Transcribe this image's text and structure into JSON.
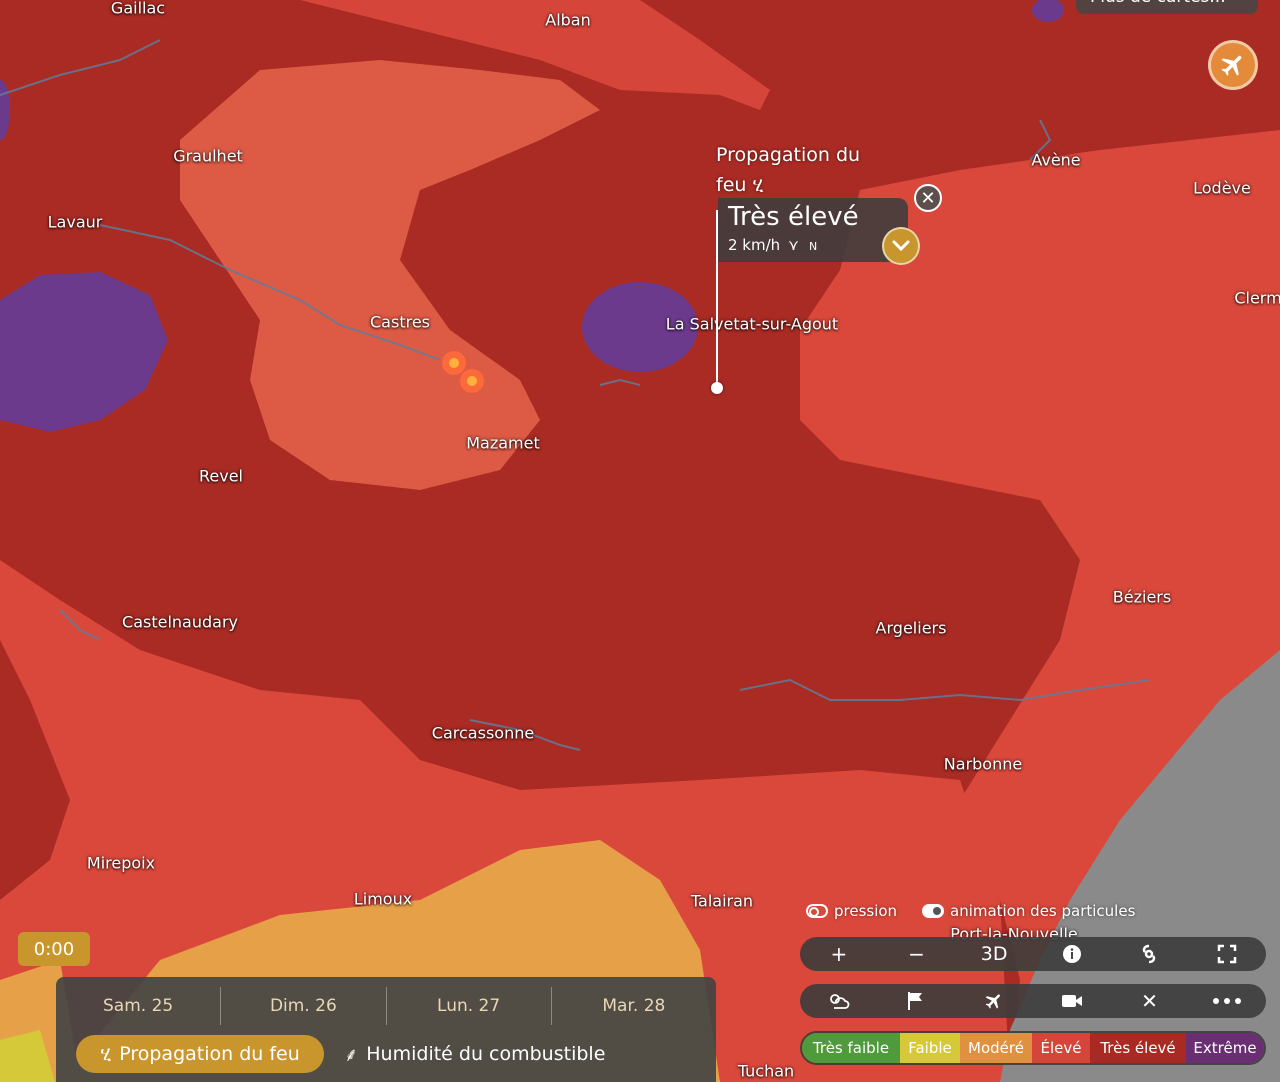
{
  "cities": [
    {
      "name": "Gaillac"
    },
    {
      "name": "Alban"
    },
    {
      "name": "Graulhet"
    },
    {
      "name": "Lavaur"
    },
    {
      "name": "Castres"
    },
    {
      "name": "La Salvetat-sur-Agout"
    },
    {
      "name": "Mazamet"
    },
    {
      "name": "Revel"
    },
    {
      "name": "Castelnaudary"
    },
    {
      "name": "Carcassonne"
    },
    {
      "name": "Mirepoix"
    },
    {
      "name": "Limoux"
    },
    {
      "name": "Talairan"
    },
    {
      "name": "Tuchan"
    },
    {
      "name": "Argeliers"
    },
    {
      "name": "Narbonne"
    },
    {
      "name": "Béziers"
    },
    {
      "name": "Avène"
    },
    {
      "name": "Lodève"
    },
    {
      "name": "Clerm"
    },
    {
      "name": "Port-la-Nouvelle"
    }
  ],
  "popup": {
    "title": "Propagation du feu",
    "level": "Très élevé",
    "wind": "2 km/h",
    "wind_dir_letter": "N",
    "close_icon": "close-icon",
    "expand_icon": "chevron-down-icon"
  },
  "top_right": {
    "more_maps": "Plus de cartes...",
    "plane_icon": "airplane-icon"
  },
  "toggles": {
    "pressure": "pression",
    "particles": "animation des particules",
    "pressure_on": false,
    "particles_on": true
  },
  "toolbar1": {
    "zoom_in": "+",
    "zoom_out": "−",
    "three_d": "3D",
    "icons": [
      "plus-icon",
      "minus-icon",
      "3d-button",
      "info-icon",
      "hurricane-icon",
      "fullscreen-icon"
    ]
  },
  "toolbar2": {
    "icons": [
      "weather-icon",
      "wind-flag-icon",
      "airplane-icon",
      "video-camera-icon",
      "close-icon",
      "more-icon"
    ]
  },
  "legend": [
    {
      "label": "Très faible",
      "color": "#4f9a3a"
    },
    {
      "label": "Faible",
      "color": "#d5c93a"
    },
    {
      "label": "Modéré",
      "color": "#e0913f"
    },
    {
      "label": "Élevé",
      "color": "#d6453a"
    },
    {
      "label": "Très élevé",
      "color": "#a82a22"
    },
    {
      "label": "Extrême",
      "color": "#6a2e72"
    }
  ],
  "timeline": {
    "time": "0:00",
    "days": [
      "Sam. 25",
      "Dim. 26",
      "Lun. 27",
      "Mar. 28"
    ],
    "active_tab": "Propagation du feu",
    "other_tab": "Humidité du combustible"
  },
  "colors": {
    "accent": "#c9962e",
    "eleve": "#dd4a37",
    "tres_eleve": "#a92b24",
    "modere": "#e6a148",
    "extreme": "#6c3a8c",
    "sea": "#8a8a8a"
  }
}
